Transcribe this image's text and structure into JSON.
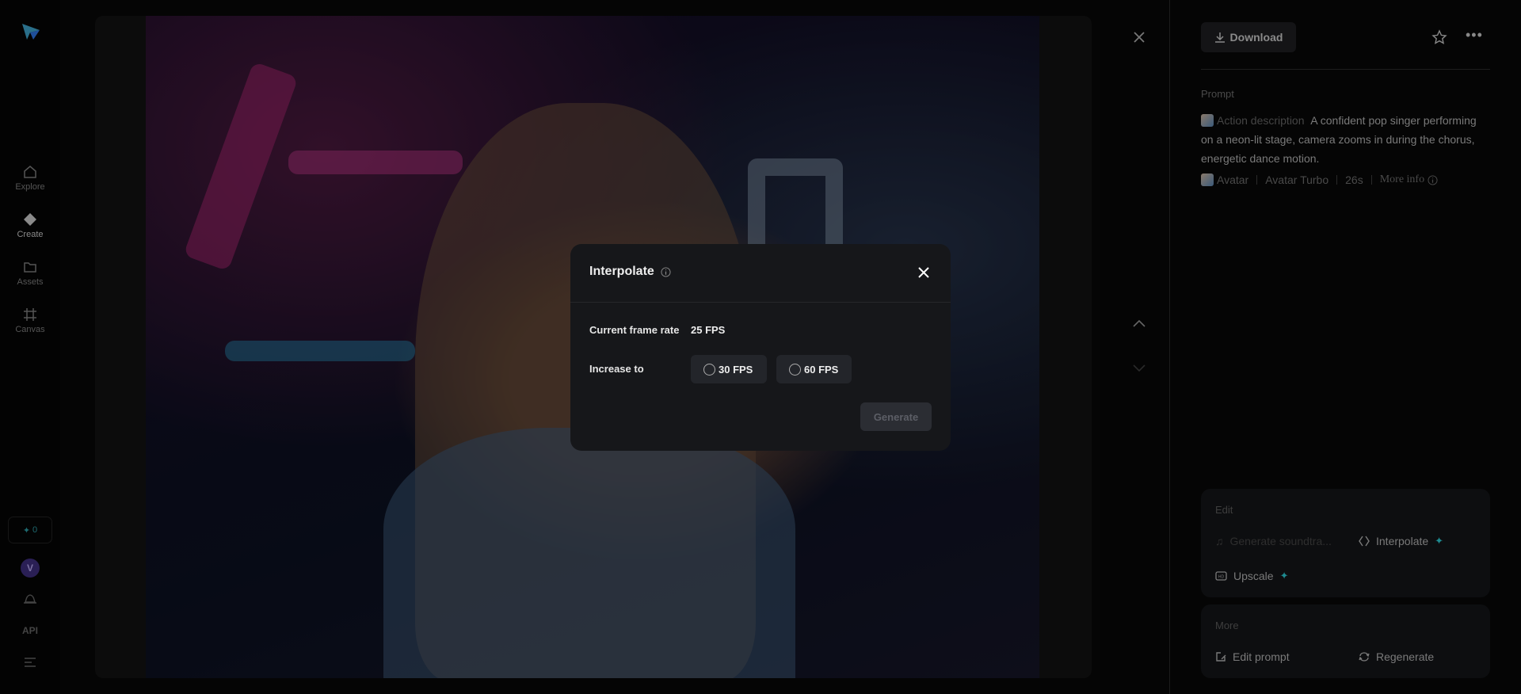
{
  "sidebar": {
    "items": [
      {
        "label": "Explore",
        "icon": "home-icon"
      },
      {
        "label": "Create",
        "icon": "diamond-icon"
      },
      {
        "label": "Assets",
        "icon": "folder-icon"
      },
      {
        "label": "Canvas",
        "icon": "frame-icon"
      }
    ],
    "credits": "0",
    "avatar_initial": "V",
    "api_label": "API"
  },
  "viewer": {
    "close": "close-icon",
    "prev": "chevron-up-icon",
    "next": "chevron-down-icon"
  },
  "panel": {
    "download_label": "Download",
    "prompt_label": "Prompt",
    "action_label": "Action description",
    "prompt_text": "A confident pop singer performing on a neon-lit stage, camera zooms in during the chorus, energetic dance motion.",
    "meta": {
      "type": "Avatar",
      "model": "Avatar Turbo",
      "duration": "26s",
      "more_info": "More info"
    },
    "edit": {
      "title": "Edit",
      "generate_soundtrack": "Generate soundtra...",
      "interpolate": "Interpolate",
      "upscale": "Upscale"
    },
    "more": {
      "title": "More",
      "edit_prompt": "Edit prompt",
      "regenerate": "Regenerate"
    }
  },
  "modal": {
    "title": "Interpolate",
    "current_label": "Current frame rate",
    "current_value": "25 FPS",
    "increase_label": "Increase to",
    "options": [
      "30 FPS",
      "60 FPS"
    ],
    "generate_label": "Generate"
  },
  "colors": {
    "accent": "#1e8a90",
    "avatar": "#3a2a6a"
  }
}
